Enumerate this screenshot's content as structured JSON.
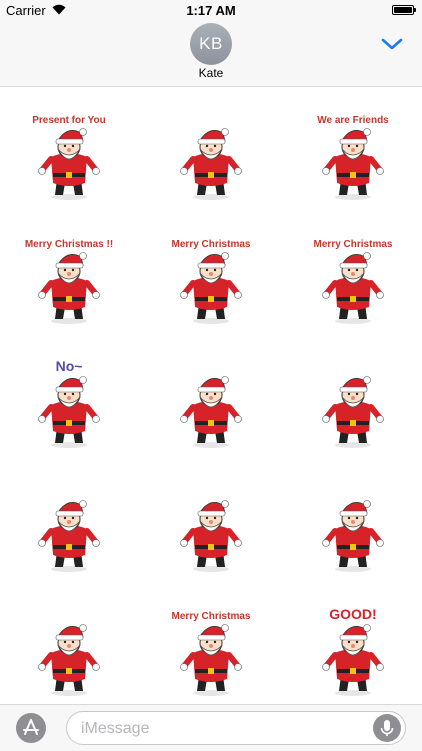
{
  "status_bar": {
    "carrier": "Carrier",
    "time": "1:17 AM",
    "battery_level": 1.0
  },
  "conversation": {
    "avatar_initials": "KB",
    "contact_name": "Kate"
  },
  "composer": {
    "placeholder": "iMessage"
  },
  "stickers": [
    {
      "name": "santa-present-for-you",
      "caption": "Present for You"
    },
    {
      "name": "santa-chimney",
      "caption": ""
    },
    {
      "name": "santa-snowman-friends",
      "caption": "We are Friends"
    },
    {
      "name": "santa-christmas-tree",
      "caption": "Merry Christmas !!"
    },
    {
      "name": "santa-reindeer-moon",
      "caption": "Merry Christmas"
    },
    {
      "name": "santa-wreath",
      "caption": "Merry Christmas"
    },
    {
      "name": "santa-no",
      "caption": "No~"
    },
    {
      "name": "santa-hearts",
      "caption": ""
    },
    {
      "name": "santa-angry",
      "caption": ""
    },
    {
      "name": "santa-shouting",
      "caption": ""
    },
    {
      "name": "santa-confused",
      "caption": ""
    },
    {
      "name": "santa-dragging-sack",
      "caption": ""
    },
    {
      "name": "santa-sticking-tongue",
      "caption": ""
    },
    {
      "name": "santa-snowman-tree",
      "caption": "Merry Christmas"
    },
    {
      "name": "santa-good",
      "caption": "GOOD!"
    }
  ],
  "colors": {
    "accent": "#1a7cf2",
    "santa_red": "#d6232a",
    "bar_bg": "#f7f7f7"
  }
}
